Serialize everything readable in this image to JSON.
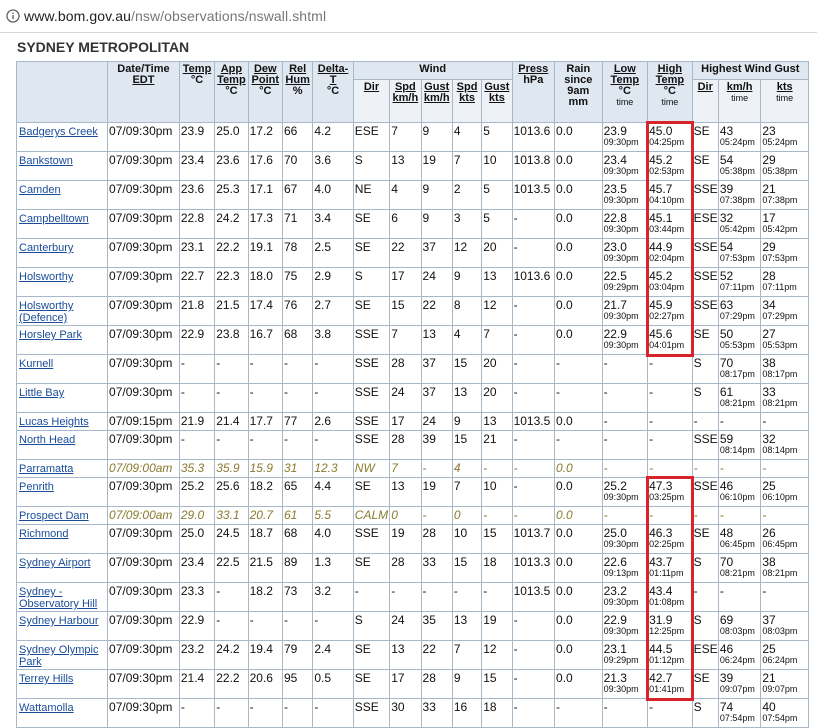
{
  "browser": {
    "url_host": "www.bom.gov.au",
    "url_path": "/nsw/observations/nswall.shtml"
  },
  "section_title": "SYDNEY METROPOLITAN",
  "headers": {
    "datetime": "Date/Time",
    "datetime_sub": "EDT",
    "temp": "Temp",
    "temp_unit": "°C",
    "app": "App",
    "app2": "Temp",
    "app_unit": "°C",
    "dew": "Dew",
    "dew2": "Point",
    "dew_unit": "°C",
    "rel": "Rel",
    "rel2": "Hum",
    "rel_unit": "%",
    "delta": "Delta-",
    "delta2": "T",
    "delta_unit": "°C",
    "wind": "Wind",
    "press": "Press",
    "press_unit": "hPa",
    "rain": "Rain",
    "rain2": "since",
    "rain3": "9am",
    "rain4": "mm",
    "low": "Low",
    "low2": "Temp",
    "low_unit": "°C",
    "low_time": "time",
    "high": "High",
    "high2": "Temp",
    "high_unit": "°C",
    "high_time": "time",
    "gust": "Highest Wind Gust",
    "wind_dir": "Dir",
    "wind_spd": "Spd",
    "wind_spd_unit": "km/h",
    "wind_gust": "Gust",
    "wind_gust_unit": "km/h",
    "wind_spd_kts": "Spd",
    "wind_spd_kts_unit": "kts",
    "wind_gust_kts": "Gust",
    "wind_gust_kts_unit": "kts",
    "gust_dir": "Dir",
    "gust_kmh": "km/h",
    "gust_kmh_time": "time",
    "gust_kts": "kts",
    "gust_kts_time": "time"
  },
  "rows": [
    {
      "station": "Badgerys Creek",
      "dt": "07/09:30pm",
      "temp": "23.9",
      "app": "25.0",
      "dew": "17.2",
      "rh": "66",
      "delta": "4.2",
      "dir": "ESE",
      "spd": "7",
      "gust": "9",
      "spdk": "4",
      "gustk": "5",
      "press": "1013.6",
      "rain": "0.0",
      "low": "23.9",
      "low_t": "09:30pm",
      "high": "45.0",
      "high_t": "04:25pm",
      "gdir": "SE",
      "gkmh": "43",
      "gkmh_t": "05:24pm",
      "gkts": "23",
      "gkts_t": "05:24pm"
    },
    {
      "station": "Bankstown",
      "dt": "07/09:30pm",
      "temp": "23.4",
      "app": "23.6",
      "dew": "17.6",
      "rh": "70",
      "delta": "3.6",
      "dir": "S",
      "spd": "13",
      "gust": "19",
      "spdk": "7",
      "gustk": "10",
      "press": "1013.8",
      "rain": "0.0",
      "low": "23.4",
      "low_t": "09:30pm",
      "high": "45.2",
      "high_t": "02:53pm",
      "gdir": "SE",
      "gkmh": "54",
      "gkmh_t": "05:38pm",
      "gkts": "29",
      "gkts_t": "05:38pm"
    },
    {
      "station": "Camden",
      "dt": "07/09:30pm",
      "temp": "23.6",
      "app": "25.3",
      "dew": "17.1",
      "rh": "67",
      "delta": "4.0",
      "dir": "NE",
      "spd": "4",
      "gust": "9",
      "spdk": "2",
      "gustk": "5",
      "press": "1013.5",
      "rain": "0.0",
      "low": "23.5",
      "low_t": "09:30pm",
      "high": "45.7",
      "high_t": "04:10pm",
      "gdir": "SSE",
      "gkmh": "39",
      "gkmh_t": "07:38pm",
      "gkts": "21",
      "gkts_t": "07:38pm"
    },
    {
      "station": "Campbelltown",
      "dt": "07/09:30pm",
      "temp": "22.8",
      "app": "24.2",
      "dew": "17.3",
      "rh": "71",
      "delta": "3.4",
      "dir": "SE",
      "spd": "6",
      "gust": "9",
      "spdk": "3",
      "gustk": "5",
      "press": "-",
      "rain": "0.0",
      "low": "22.8",
      "low_t": "09:30pm",
      "high": "45.1",
      "high_t": "03:44pm",
      "gdir": "ESE",
      "gkmh": "32",
      "gkmh_t": "05:42pm",
      "gkts": "17",
      "gkts_t": "05:42pm"
    },
    {
      "station": "Canterbury",
      "dt": "07/09:30pm",
      "temp": "23.1",
      "app": "22.2",
      "dew": "19.1",
      "rh": "78",
      "delta": "2.5",
      "dir": "SE",
      "spd": "22",
      "gust": "37",
      "spdk": "12",
      "gustk": "20",
      "press": "-",
      "rain": "0.0",
      "low": "23.0",
      "low_t": "09:30pm",
      "high": "44.9",
      "high_t": "02:04pm",
      "gdir": "SSE",
      "gkmh": "54",
      "gkmh_t": "07:53pm",
      "gkts": "29",
      "gkts_t": "07:53pm"
    },
    {
      "station": "Holsworthy",
      "dt": "07/09:30pm",
      "temp": "22.7",
      "app": "22.3",
      "dew": "18.0",
      "rh": "75",
      "delta": "2.9",
      "dir": "S",
      "spd": "17",
      "gust": "24",
      "spdk": "9",
      "gustk": "13",
      "press": "1013.6",
      "rain": "0.0",
      "low": "22.5",
      "low_t": "09:29pm",
      "high": "45.2",
      "high_t": "03:04pm",
      "gdir": "SSE",
      "gkmh": "52",
      "gkmh_t": "07:11pm",
      "gkts": "28",
      "gkts_t": "07:11pm"
    },
    {
      "station": "Holsworthy (Defence)",
      "dt": "07/09:30pm",
      "temp": "21.8",
      "app": "21.5",
      "dew": "17.4",
      "rh": "76",
      "delta": "2.7",
      "dir": "SE",
      "spd": "15",
      "gust": "22",
      "spdk": "8",
      "gustk": "12",
      "press": "-",
      "rain": "0.0",
      "low": "21.7",
      "low_t": "09:30pm",
      "high": "45.9",
      "high_t": "02:27pm",
      "gdir": "SSE",
      "gkmh": "63",
      "gkmh_t": "07:29pm",
      "gkts": "34",
      "gkts_t": "07:29pm"
    },
    {
      "station": "Horsley Park",
      "dt": "07/09:30pm",
      "temp": "22.9",
      "app": "23.8",
      "dew": "16.7",
      "rh": "68",
      "delta": "3.8",
      "dir": "SSE",
      "spd": "7",
      "gust": "13",
      "spdk": "4",
      "gustk": "7",
      "press": "-",
      "rain": "0.0",
      "low": "22.9",
      "low_t": "09:30pm",
      "high": "45.6",
      "high_t": "04:01pm",
      "gdir": "SE",
      "gkmh": "50",
      "gkmh_t": "05:53pm",
      "gkts": "27",
      "gkts_t": "05:53pm"
    },
    {
      "station": "Kurnell",
      "dt": "07/09:30pm",
      "temp": "-",
      "app": "-",
      "dew": "-",
      "rh": "-",
      "delta": "-",
      "dir": "SSE",
      "spd": "28",
      "gust": "37",
      "spdk": "15",
      "gustk": "20",
      "press": "-",
      "rain": "-",
      "low": "-",
      "low_t": "",
      "high": "-",
      "high_t": "",
      "gdir": "S",
      "gkmh": "70",
      "gkmh_t": "08:17pm",
      "gkts": "38",
      "gkts_t": "08:17pm"
    },
    {
      "station": "Little Bay",
      "dt": "07/09:30pm",
      "temp": "-",
      "app": "-",
      "dew": "-",
      "rh": "-",
      "delta": "-",
      "dir": "SSE",
      "spd": "24",
      "gust": "37",
      "spdk": "13",
      "gustk": "20",
      "press": "-",
      "rain": "-",
      "low": "-",
      "low_t": "",
      "high": "-",
      "high_t": "",
      "gdir": "S",
      "gkmh": "61",
      "gkmh_t": "08:21pm",
      "gkts": "33",
      "gkts_t": "08:21pm"
    },
    {
      "station": "Lucas Heights",
      "dt": "07/09:15pm",
      "temp": "21.9",
      "app": "21.4",
      "dew": "17.7",
      "rh": "77",
      "delta": "2.6",
      "dir": "SSE",
      "spd": "17",
      "gust": "24",
      "spdk": "9",
      "gustk": "13",
      "press": "1013.5",
      "rain": "0.0",
      "low": "-",
      "low_t": "",
      "high": "-",
      "high_t": "",
      "gdir": "-",
      "gkmh": "-",
      "gkmh_t": "",
      "gkts": "-",
      "gkts_t": "",
      "short": true
    },
    {
      "station": "North Head",
      "dt": "07/09:30pm",
      "temp": "-",
      "app": "-",
      "dew": "-",
      "rh": "-",
      "delta": "-",
      "dir": "SSE",
      "spd": "28",
      "gust": "39",
      "spdk": "15",
      "gustk": "21",
      "press": "-",
      "rain": "-",
      "low": "-",
      "low_t": "",
      "high": "-",
      "high_t": "",
      "gdir": "SSE",
      "gkmh": "59",
      "gkmh_t": "08:14pm",
      "gkts": "32",
      "gkts_t": "08:14pm"
    },
    {
      "station": "Parramatta",
      "dt": "07/09:00am",
      "temp": "35.3",
      "app": "35.9",
      "dew": "15.9",
      "rh": "31",
      "delta": "12.3",
      "dir": "NW",
      "spd": "7",
      "gust": "-",
      "spdk": "4",
      "gustk": "-",
      "press": "-",
      "rain": "0.0",
      "low": "-",
      "low_t": "",
      "high": "-",
      "high_t": "",
      "gdir": "-",
      "gkmh": "-",
      "gkmh_t": "",
      "gkts": "-",
      "gkts_t": "",
      "short": true,
      "old": true
    },
    {
      "station": "Penrith",
      "dt": "07/09:30pm",
      "temp": "25.2",
      "app": "25.6",
      "dew": "18.2",
      "rh": "65",
      "delta": "4.4",
      "dir": "SE",
      "spd": "13",
      "gust": "19",
      "spdk": "7",
      "gustk": "10",
      "press": "-",
      "rain": "0.0",
      "low": "25.2",
      "low_t": "09:30pm",
      "high": "47.3",
      "high_t": "03:25pm",
      "gdir": "SSE",
      "gkmh": "46",
      "gkmh_t": "06:10pm",
      "gkts": "25",
      "gkts_t": "06:10pm"
    },
    {
      "station": "Prospect Dam",
      "dt": "07/09:00am",
      "temp": "29.0",
      "app": "33.1",
      "dew": "20.7",
      "rh": "61",
      "delta": "5.5",
      "dir": "CALM",
      "spd": "0",
      "gust": "-",
      "spdk": "0",
      "gustk": "-",
      "press": "-",
      "rain": "0.0",
      "low": "-",
      "low_t": "",
      "high": "-",
      "high_t": "",
      "gdir": "-",
      "gkmh": "-",
      "gkmh_t": "",
      "gkts": "-",
      "gkts_t": "",
      "short": true,
      "old": true
    },
    {
      "station": "Richmond",
      "dt": "07/09:30pm",
      "temp": "25.0",
      "app": "24.5",
      "dew": "18.7",
      "rh": "68",
      "delta": "4.0",
      "dir": "SSE",
      "spd": "19",
      "gust": "28",
      "spdk": "10",
      "gustk": "15",
      "press": "1013.7",
      "rain": "0.0",
      "low": "25.0",
      "low_t": "09:30pm",
      "high": "46.3",
      "high_t": "02:25pm",
      "gdir": "SE",
      "gkmh": "48",
      "gkmh_t": "06:45pm",
      "gkts": "26",
      "gkts_t": "06:45pm"
    },
    {
      "station": "Sydney Airport",
      "dt": "07/09:30pm",
      "temp": "23.4",
      "app": "22.5",
      "dew": "21.5",
      "rh": "89",
      "delta": "1.3",
      "dir": "SE",
      "spd": "28",
      "gust": "33",
      "spdk": "15",
      "gustk": "18",
      "press": "1013.3",
      "rain": "0.0",
      "low": "22.6",
      "low_t": "09:13pm",
      "high": "43.7",
      "high_t": "01:11pm",
      "gdir": "S",
      "gkmh": "70",
      "gkmh_t": "08:21pm",
      "gkts": "38",
      "gkts_t": "08:21pm"
    },
    {
      "station": "Sydney - Observatory Hill",
      "dt": "07/09:30pm",
      "temp": "23.3",
      "app": "-",
      "dew": "18.2",
      "rh": "73",
      "delta": "3.2",
      "dir": "-",
      "spd": "-",
      "gust": "-",
      "spdk": "-",
      "gustk": "-",
      "press": "1013.5",
      "rain": "0.0",
      "low": "23.2",
      "low_t": "09:30pm",
      "high": "43.4",
      "high_t": "01:08pm",
      "gdir": "-",
      "gkmh": "-",
      "gkmh_t": "",
      "gkts": "-",
      "gkts_t": ""
    },
    {
      "station": "Sydney Harbour",
      "dt": "07/09:30pm",
      "temp": "22.9",
      "app": "-",
      "dew": "-",
      "rh": "-",
      "delta": "-",
      "dir": "S",
      "spd": "24",
      "gust": "35",
      "spdk": "13",
      "gustk": "19",
      "press": "-",
      "rain": "0.0",
      "low": "22.9",
      "low_t": "09:30pm",
      "high": "31.9",
      "high_t": "12:25pm",
      "gdir": "S",
      "gkmh": "69",
      "gkmh_t": "08:03pm",
      "gkts": "37",
      "gkts_t": "08:03pm"
    },
    {
      "station": "Sydney Olympic Park",
      "dt": "07/09:30pm",
      "temp": "23.2",
      "app": "24.2",
      "dew": "19.4",
      "rh": "79",
      "delta": "2.4",
      "dir": "SE",
      "spd": "13",
      "gust": "22",
      "spdk": "7",
      "gustk": "12",
      "press": "-",
      "rain": "0.0",
      "low": "23.1",
      "low_t": "09:29pm",
      "high": "44.5",
      "high_t": "01:12pm",
      "gdir": "ESE",
      "gkmh": "46",
      "gkmh_t": "06:24pm",
      "gkts": "25",
      "gkts_t": "06:24pm"
    },
    {
      "station": "Terrey Hills",
      "dt": "07/09:30pm",
      "temp": "21.4",
      "app": "22.2",
      "dew": "20.6",
      "rh": "95",
      "delta": "0.5",
      "dir": "SE",
      "spd": "17",
      "gust": "28",
      "spdk": "9",
      "gustk": "15",
      "press": "-",
      "rain": "0.0",
      "low": "21.3",
      "low_t": "09:30pm",
      "high": "42.7",
      "high_t": "01:41pm",
      "gdir": "SE",
      "gkmh": "39",
      "gkmh_t": "09:07pm",
      "gkts": "21",
      "gkts_t": "09:07pm"
    },
    {
      "station": "Wattamolla",
      "dt": "07/09:30pm",
      "temp": "-",
      "app": "-",
      "dew": "-",
      "rh": "-",
      "delta": "-",
      "dir": "SSE",
      "spd": "30",
      "gust": "33",
      "spdk": "16",
      "gustk": "18",
      "press": "-",
      "rain": "-",
      "low": "-",
      "low_t": "",
      "high": "-",
      "high_t": "",
      "gdir": "S",
      "gkmh": "74",
      "gkmh_t": "07:54pm",
      "gkts": "40",
      "gkts_t": "07:54pm"
    }
  ],
  "colors": {
    "highlight": "#d8232a",
    "header_bg": "#dfe7f1",
    "link": "#1a4d99"
  }
}
